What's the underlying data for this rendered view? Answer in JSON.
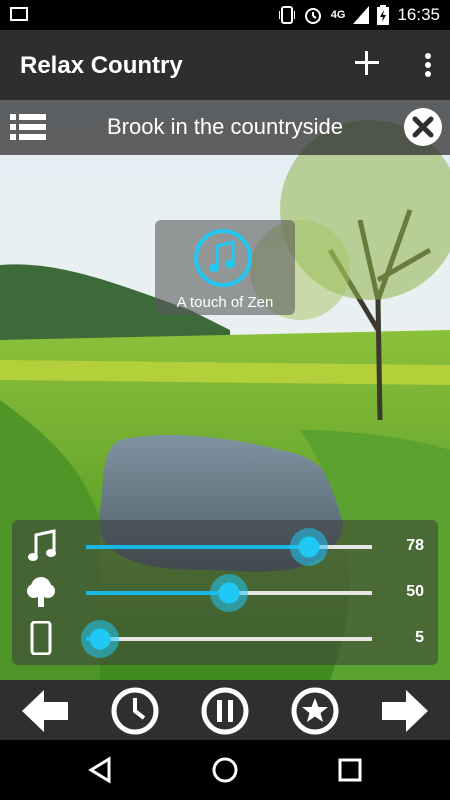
{
  "status_bar": {
    "network": "4G",
    "time": "16:35"
  },
  "app_bar": {
    "title": "Relax Country"
  },
  "track": {
    "name": "Brook in the countryside"
  },
  "preset": {
    "label": "A touch of Zen"
  },
  "mixer": {
    "sliders": [
      {
        "icon": "music-note-icon",
        "value": "78",
        "level": 78
      },
      {
        "icon": "tree-icon",
        "value": "50",
        "level": 50
      },
      {
        "icon": "phone-icon",
        "value": "5",
        "level": 5
      }
    ]
  },
  "colors": {
    "accent": "#1bb7e4",
    "bar": "#2e2e2e"
  }
}
